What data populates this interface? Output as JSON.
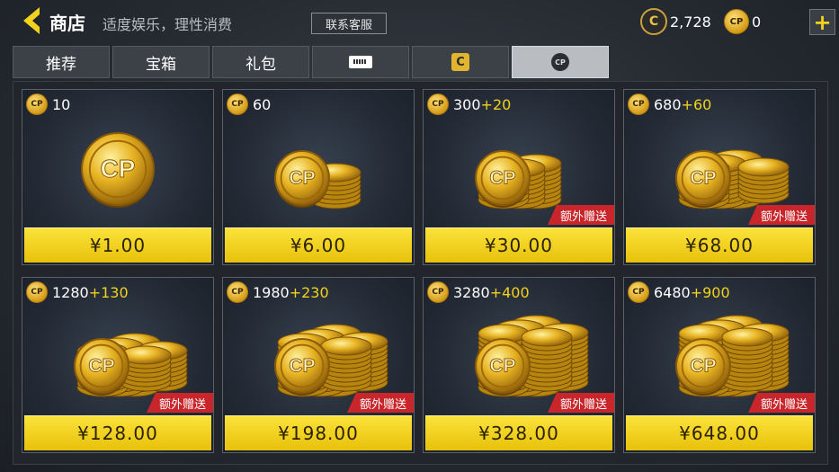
{
  "header": {
    "title": "商店",
    "subtitle": "适度娱乐，理性消费",
    "support_label": "联系客服",
    "currency_c": {
      "icon": "c-coin-icon",
      "value": "2,728"
    },
    "currency_cp": {
      "icon": "cp-coin-icon",
      "value": "0"
    },
    "plus": "+"
  },
  "tabs": [
    {
      "label": "推荐"
    },
    {
      "label": "宝箱"
    },
    {
      "label": "礼包"
    },
    {
      "icon": "ticket-icon"
    },
    {
      "icon": "c-icon",
      "glyph": "C"
    },
    {
      "icon": "cp-icon",
      "glyph": "CP",
      "active": true
    }
  ],
  "items": [
    {
      "base": "10",
      "bonus": "",
      "price": "¥1.00",
      "tag": ""
    },
    {
      "base": "60",
      "bonus": "",
      "price": "¥6.00",
      "tag": ""
    },
    {
      "base": "300",
      "bonus": "+20",
      "price": "¥30.00",
      "tag": "额外赠送"
    },
    {
      "base": "680",
      "bonus": "+60",
      "price": "¥68.00",
      "tag": "额外赠送"
    },
    {
      "base": "1280",
      "bonus": "+130",
      "price": "¥128.00",
      "tag": "额外赠送"
    },
    {
      "base": "1980",
      "bonus": "+230",
      "price": "¥198.00",
      "tag": "额外赠送"
    },
    {
      "base": "3280",
      "bonus": "+400",
      "price": "¥328.00",
      "tag": "额外赠送"
    },
    {
      "base": "6480",
      "bonus": "+900",
      "price": "¥648.00",
      "tag": "额外赠送"
    }
  ],
  "coin_label": "CP",
  "colors": {
    "accent_yellow": "#f2d21c",
    "tag_red": "#c8262b",
    "price_bar": "#fbe23a"
  }
}
